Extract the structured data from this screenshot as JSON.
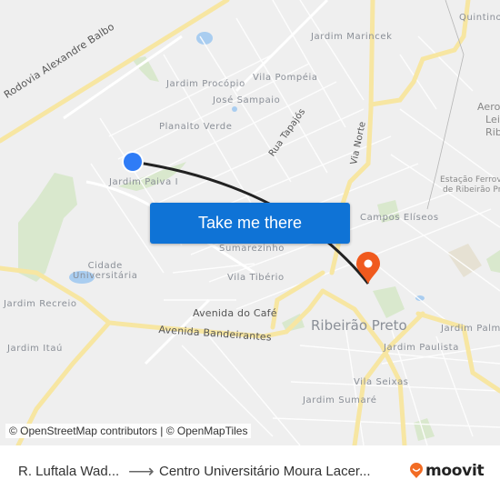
{
  "map": {
    "labels": {
      "rodovia": "Rodovia Alexandre Balbo",
      "jardim_marincek": "Jardim Marincek",
      "quintino": "Quintino",
      "jardim_procopio": "Jardim Procópio",
      "vila_pompeia": "Vila Pompéia",
      "jose_sampaio": "José Sampaio",
      "planalto_verde": "Planalto Verde",
      "rua_tapajos": "Rua Tapajós",
      "via_norte": "Via Norte",
      "aeroporto_1": "Aerop",
      "aeroporto_2": "Leit",
      "aeroporto_3": "Rib",
      "jardim_paiva": "Jardim Paiva I",
      "estacao_1": "Estação Ferroviá",
      "estacao_2": "de Ribeirão Pre",
      "campos_eliseos": "Campos Elíseos",
      "sumarezinho": "Sumarezinho",
      "cidade_universitaria_1": "Cidade",
      "cidade_universitaria_2": "Universitária",
      "vila_tiberio": "Vila Tibério",
      "jardim_recreio": "Jardim Recreio",
      "avenida_do_cafe": "Avenida do Café",
      "avenida_bandeirantes": "Avenida Bandeirantes",
      "ribeirao_preto": "Ribeirão Preto",
      "jardim_palma": "Jardim Palm",
      "jardim_itau": "Jardim Itaú",
      "jardim_paulista": "Jardim Paulista",
      "vila_seixas": "Vila Seixas",
      "jardim_sumare": "Jardim Sumaré"
    },
    "origin_marker_color": "#2f7cf6",
    "destination_marker_color": "#f05a1e",
    "route_color": "#222222",
    "cta_label": "Take me there",
    "attribution": "© OpenStreetMap contributors | © OpenMapTiles"
  },
  "footer": {
    "from": "R. Luftala Wad...",
    "arrow": "⟶",
    "to": "Centro Universitário Moura Lacer...",
    "brand": "moovit",
    "brand_color": "#f26c24"
  }
}
